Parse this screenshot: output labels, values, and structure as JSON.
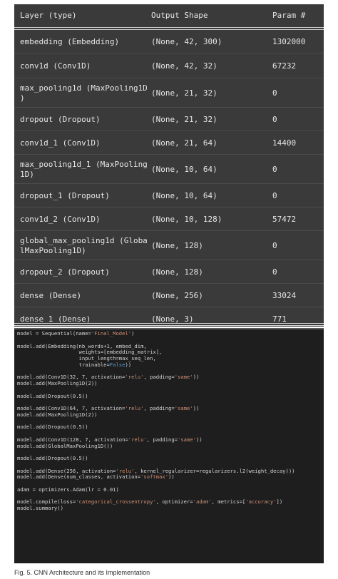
{
  "summary": {
    "headers": {
      "layer": "Layer (type)",
      "shape": "Output Shape",
      "param": "Param #"
    },
    "rows": [
      {
        "layer": "embedding (Embedding)",
        "shape": "(None, 42, 300)",
        "param": "1302000"
      },
      {
        "layer": "conv1d (Conv1D)",
        "shape": "(None, 42, 32)",
        "param": "67232"
      },
      {
        "layer": "max_pooling1d (MaxPooling1D )",
        "shape": "(None, 21, 32)",
        "param": "0"
      },
      {
        "layer": "dropout (Dropout)",
        "shape": "(None, 21, 32)",
        "param": "0"
      },
      {
        "layer": "conv1d_1 (Conv1D)",
        "shape": "(None, 21, 64)",
        "param": "14400"
      },
      {
        "layer": "max_pooling1d_1 (MaxPooling 1D)",
        "shape": "(None, 10, 64)",
        "param": "0"
      },
      {
        "layer": "dropout_1 (Dropout)",
        "shape": "(None, 10, 64)",
        "param": "0"
      },
      {
        "layer": "conv1d_2 (Conv1D)",
        "shape": "(None, 10, 128)",
        "param": "57472"
      },
      {
        "layer": "global_max_pooling1d (Globa lMaxPooling1D)",
        "shape": "(None, 128)",
        "param": "0"
      },
      {
        "layer": "dropout_2 (Dropout)",
        "shape": "(None, 128)",
        "param": "0"
      },
      {
        "layer": "dense (Dense)",
        "shape": "(None, 256)",
        "param": "33024"
      },
      {
        "layer": "dense_1 (Dense)",
        "shape": "(None, 3)",
        "param": "771"
      }
    ]
  },
  "code": [
    [
      {
        "t": "model = Sequential(name="
      },
      {
        "t": "'Final_Model'",
        "k": "str"
      },
      {
        "t": ")"
      }
    ],
    [],
    [
      {
        "t": "model.add(Embedding(nb_words+1, embed_dim,"
      }
    ],
    [
      {
        "t": "                    weights=[embedding_matrix],"
      }
    ],
    [
      {
        "t": "                    input_length=max_seq_len,"
      }
    ],
    [
      {
        "t": "                    trainable="
      },
      {
        "t": "False",
        "k": "kw"
      },
      {
        "t": "))"
      }
    ],
    [],
    [
      {
        "t": "model.add(Conv1D(32, 7, activation="
      },
      {
        "t": "'relu'",
        "k": "str"
      },
      {
        "t": ", padding="
      },
      {
        "t": "'same'",
        "k": "str"
      },
      {
        "t": "))"
      }
    ],
    [
      {
        "t": "model.add(MaxPooling1D(2))"
      }
    ],
    [],
    [
      {
        "t": "model.add(Dropout(0.5))"
      }
    ],
    [],
    [
      {
        "t": "model.add(Conv1D(64, 7, activation="
      },
      {
        "t": "'relu'",
        "k": "str"
      },
      {
        "t": ", padding="
      },
      {
        "t": "'same'",
        "k": "str"
      },
      {
        "t": "))"
      }
    ],
    [
      {
        "t": "model.add(MaxPooling1D(2))"
      }
    ],
    [],
    [
      {
        "t": "model.add(Dropout(0.5))"
      }
    ],
    [],
    [
      {
        "t": "model.add(Conv1D(128, 7, activation="
      },
      {
        "t": "'relu'",
        "k": "str"
      },
      {
        "t": ", padding="
      },
      {
        "t": "'same'",
        "k": "str"
      },
      {
        "t": "))"
      }
    ],
    [
      {
        "t": "model.add(GlobalMaxPooling1D())"
      }
    ],
    [],
    [
      {
        "t": "model.add(Dropout(0.5))"
      }
    ],
    [],
    [
      {
        "t": "model.add(Dense(256, activation="
      },
      {
        "t": "'relu'",
        "k": "str"
      },
      {
        "t": ", kernel_regularizer=regularizers.l2(weight_decay)))"
      }
    ],
    [
      {
        "t": "model.add(Dense(num_classes, activation="
      },
      {
        "t": "'softmax'",
        "k": "str"
      },
      {
        "t": "))"
      }
    ],
    [],
    [
      {
        "t": "adam = optimizers.Adam(lr = 0.01)"
      }
    ],
    [],
    [
      {
        "t": "model.compile(loss="
      },
      {
        "t": "'categorical_crossentropy'",
        "k": "str"
      },
      {
        "t": ", optimizer="
      },
      {
        "t": "'adam'",
        "k": "str"
      },
      {
        "t": ", metrics=["
      },
      {
        "t": "'accuracy'",
        "k": "str"
      },
      {
        "t": "])"
      }
    ],
    [
      {
        "t": "model.summary()"
      }
    ]
  ],
  "caption": "Fig. 5. CNN Architecture and its Implementation"
}
